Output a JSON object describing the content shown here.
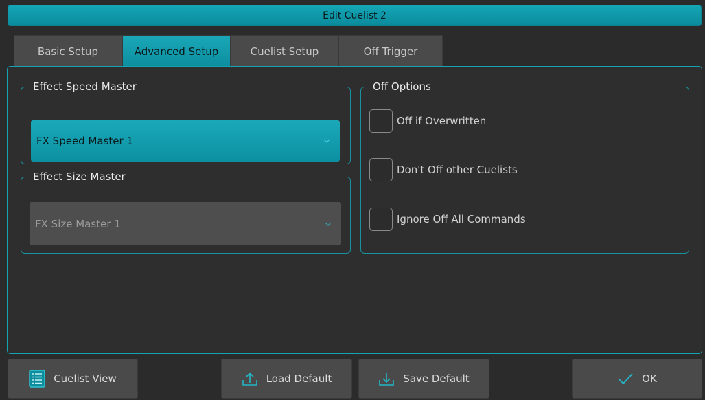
{
  "window": {
    "title": "Edit Cuelist 2"
  },
  "tabs": [
    {
      "label": "Basic Setup",
      "active": false
    },
    {
      "label": "Advanced Setup",
      "active": true
    },
    {
      "label": "Cuelist Setup",
      "active": false
    },
    {
      "label": "Off Trigger",
      "active": false
    }
  ],
  "effect_speed_master": {
    "legend": "Effect Speed Master",
    "selected": "FX Speed Master 1"
  },
  "effect_size_master": {
    "legend": "Effect Size Master",
    "selected": "FX Size Master 1"
  },
  "off_options": {
    "legend": "Off Options",
    "items": [
      {
        "label": "Off if Overwritten",
        "checked": false
      },
      {
        "label": "Don't Off other Cuelists",
        "checked": false
      },
      {
        "label": "Ignore Off All Commands",
        "checked": false
      }
    ]
  },
  "footer": {
    "cuelist_view": "Cuelist View",
    "load_default": "Load Default",
    "save_default": "Save Default",
    "ok": "OK"
  },
  "colors": {
    "accent": "#0fa0b1",
    "background": "#2b2b2b",
    "button": "#4a4a4a"
  },
  "icons": {
    "cuelist_view": "list-icon",
    "load_default": "upload-arrow-icon",
    "save_default": "download-arrow-icon",
    "ok": "checkmark-icon",
    "dropdown": "chevron-down-icon"
  }
}
